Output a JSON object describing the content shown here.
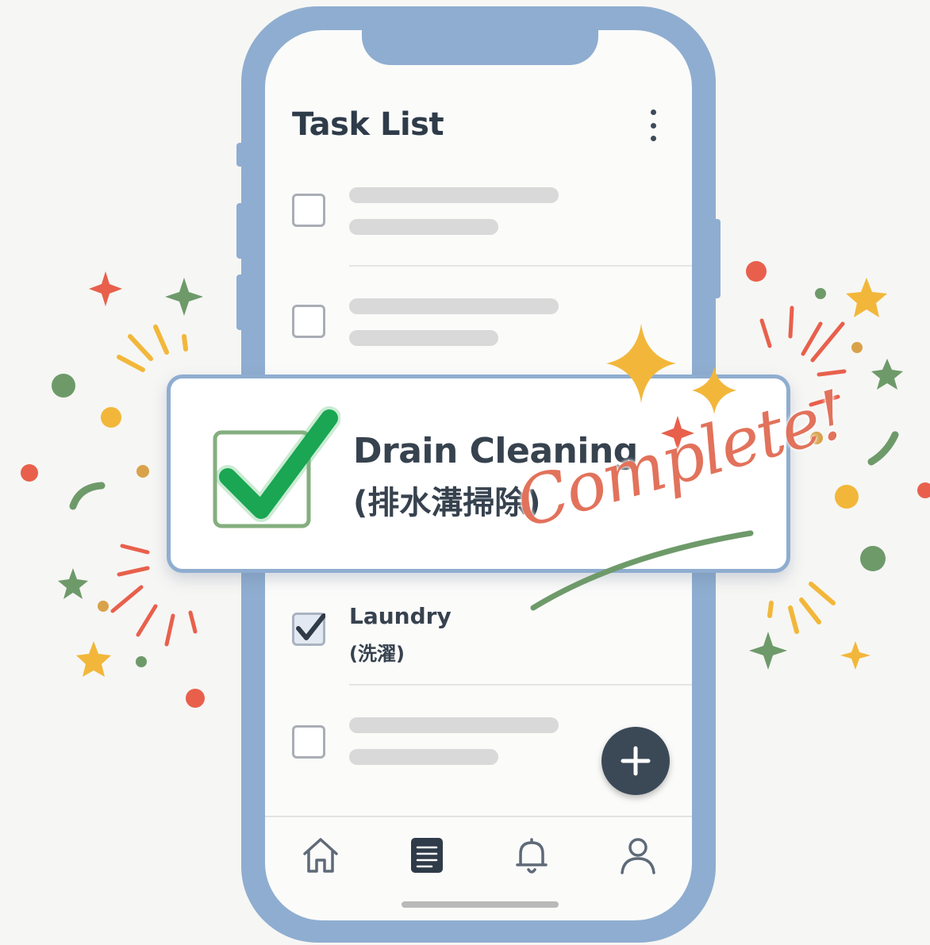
{
  "app": {
    "title": "Task List"
  },
  "tasks": [
    {
      "status": "incomplete",
      "placeholder": true
    },
    {
      "status": "incomplete",
      "placeholder": true
    },
    {
      "status": "complete",
      "title": "Laundry",
      "subtitle": "(洗濯)"
    },
    {
      "status": "incomplete",
      "placeholder": true
    }
  ],
  "popup": {
    "title": "Drain Cleaning",
    "subtitle": "(排水溝掃除)",
    "badge": "Complete!"
  },
  "fab": {
    "icon": "plus-icon"
  },
  "bottom_nav": [
    {
      "icon": "home-icon"
    },
    {
      "icon": "task-list-icon",
      "active": true
    },
    {
      "icon": "bell-icon"
    },
    {
      "icon": "user-icon"
    }
  ],
  "colors": {
    "phone_frame": "#8fadd0",
    "text_dark": "#37424f",
    "check_green": "#1aa653",
    "accent_coral": "#e2725b",
    "fab": "#3b4957"
  }
}
